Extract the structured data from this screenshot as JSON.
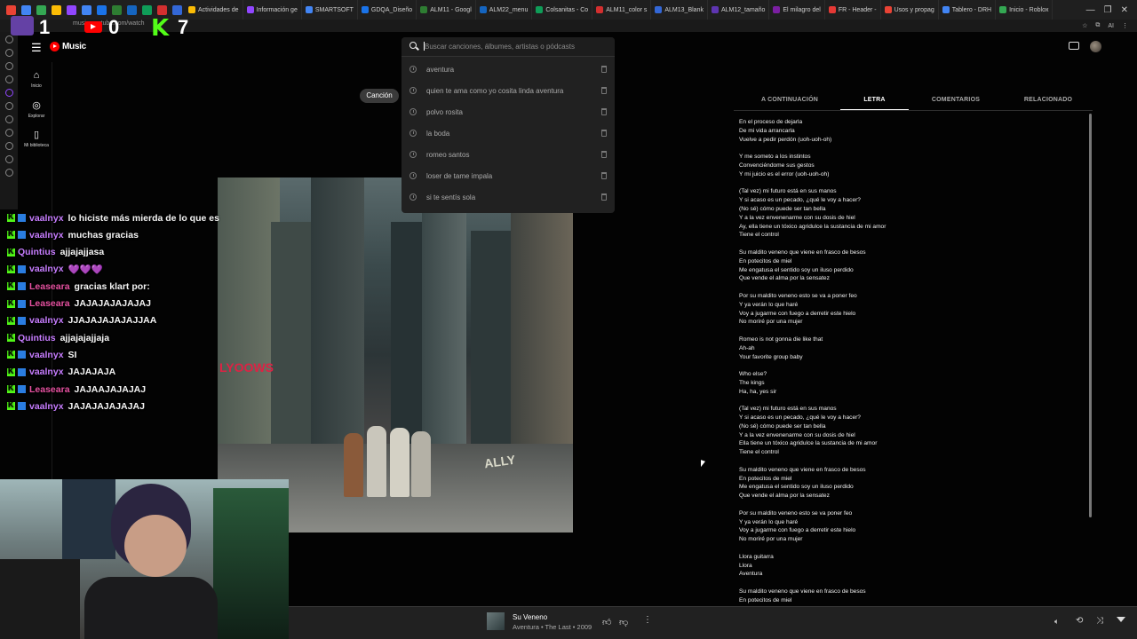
{
  "browser": {
    "tabs": [
      "Actividades de",
      "Información ge",
      "SMARTSOFT",
      "GDQA_Diseño",
      "ALM11 - Googl",
      "ALM22_menu",
      "Colsanitas - Co",
      "ALM11_color s",
      "ALM13_Blank",
      "ALM12_tamaño",
      "El milagro del",
      "FR - Header -",
      "Usos y propag",
      "Tablero - DRH",
      "Inicio - Roblox"
    ],
    "address": "music.youtube.com/watch",
    "ai_label": "AI"
  },
  "overlay": {
    "score_left": "1",
    "score_mid": "0",
    "score_right": "7",
    "kick_mark": "K"
  },
  "app": {
    "name": "Music",
    "nav": [
      {
        "label": "Inicio",
        "icon": "home-icon"
      },
      {
        "label": "Explorar",
        "icon": "explore-icon"
      },
      {
        "label": "Mi biblioteca",
        "icon": "library-icon"
      }
    ]
  },
  "search": {
    "placeholder": "Buscar canciones, álbumes, artistas o pódcasts",
    "history": [
      "aventura",
      "quien te ama como yo cosita linda aventura",
      "polvo rosita",
      "la boda",
      "romeo santos",
      "loser de tame impala",
      "si te sentís sola"
    ]
  },
  "toggle": {
    "song_label": "Canción"
  },
  "panel_tabs": [
    "A CONTINUACIÓN",
    "LETRA",
    "COMENTARIOS",
    "RELACIONADO"
  ],
  "active_tab": "LETRA",
  "lyrics": [
    "En el proceso de dejarla",
    "De mi vida arrancarla",
    "Vuelve a pedir perdón (uoh-uoh-oh)",
    "",
    "Y me someto a los instintos",
    "Convenciéndome sus gestos",
    "Y mi juicio es el error (uoh-uoh-oh)",
    "",
    "(Tal vez) mi futuro está en sus manos",
    "Y si acaso es un pecado, ¿qué le voy a hacer?",
    "(No sé) cómo puede ser tan bella",
    "Y a la vez envenenarme con su dosis de hiel",
    "Ay, ella tiene un tóxico agridulce la sustancia de mi amor",
    "Tiene el control",
    "",
    "Su maldito veneno que viene en frasco de besos",
    "En potecitos de miel",
    "Me engatusa el sentido soy un iluso perdido",
    "Que vende el alma por la sensatez",
    "",
    "Por su maldito veneno esto se va a poner feo",
    "Y ya verán lo que haré",
    "Voy a jugarme con fuego a derretir este hielo",
    "No moriré por una mujer",
    "",
    "Romeo is not gonna die like that",
    "Ah-ah",
    "Your favorite group baby",
    "",
    "Who else?",
    "The kings",
    "Ha, ha, yes sir",
    "",
    "(Tal vez) mi futuro está en sus manos",
    "Y si acaso es un pecado, ¿qué le voy a hacer?",
    "(No sé) cómo puede ser tan bella",
    "Y a la vez envenenarme con su dosis de hiel",
    "Ella tiene un tóxico agridulce la sustancia de mi amor",
    "Tiene el control",
    "",
    "Su maldito veneno que viene en frasco de besos",
    "En potecitos de miel",
    "Me engatusa el sentido soy un iluso perdido",
    "Que vende el alma por la sensatez",
    "",
    "Por su maldito veneno esto se va poner feo",
    "Y ya verán lo que haré",
    "Voy a jugarme con fuego a derretir este hielo",
    "No moriré por una mujer",
    "",
    "Llora guitarra",
    "Llora",
    "Aventura",
    "",
    "Su maldito veneno que viene en frasco de besos",
    "En potecitos de miel"
  ],
  "album_art": {
    "sign_text": "LYOOWS",
    "street_word": "ALLY"
  },
  "player": {
    "title": "Su Veneno",
    "subtitle": "Aventura • The Last • 2009"
  },
  "chat": [
    {
      "user": "vaalnyx",
      "msg": "lo hiciste más mierda de lo que es",
      "color": "#c77dff",
      "badge2": true
    },
    {
      "user": "vaalnyx",
      "msg": "muchas gracias",
      "color": "#c77dff",
      "badge2": true
    },
    {
      "user": "Quintius",
      "msg": "ajjajajjasa",
      "color": "#c77dff",
      "badge2": false
    },
    {
      "user": "vaalnyx",
      "msg": "💜💜💜",
      "color": "#c77dff",
      "badge2": true
    },
    {
      "user": "Leaseara",
      "msg": "gracias klart por:",
      "color": "#e651a0",
      "badge2": true
    },
    {
      "user": "Leaseara",
      "msg": "JAJAJAJAJAJAJ",
      "color": "#e651a0",
      "badge2": true
    },
    {
      "user": "vaalnyx",
      "msg": "JJAJAJAJAJAJJAA",
      "color": "#c77dff",
      "badge2": true
    },
    {
      "user": "Quintius",
      "msg": "ajjajajajjaja",
      "color": "#c77dff",
      "badge2": false
    },
    {
      "user": "vaalnyx",
      "msg": "SI",
      "color": "#c77dff",
      "badge2": true
    },
    {
      "user": "vaalnyx",
      "msg": "JAJAJAJA",
      "color": "#c77dff",
      "badge2": true
    },
    {
      "user": "Leaseara",
      "msg": "JAJAAJAJAJAJ",
      "color": "#e651a0",
      "badge2": true
    },
    {
      "user": "vaalnyx",
      "msg": "JAJAJAJAJAJAJ",
      "color": "#c77dff",
      "badge2": true
    }
  ],
  "colors": {
    "accent": "#ff0000",
    "kick": "#53fc18",
    "background": "#030303"
  }
}
